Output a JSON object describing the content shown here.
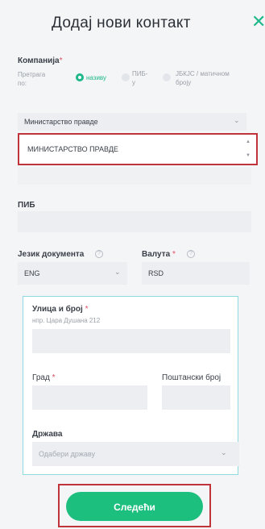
{
  "header": {
    "title": "Додај нови контакт",
    "close_glyph": "✕"
  },
  "company": {
    "label": "Компанија",
    "required_mark": "*",
    "search_by_label_1": "Претрага",
    "search_by_label_2": "по:",
    "options": [
      {
        "label_1": "називу",
        "label_2": "",
        "selected": true
      },
      {
        "label_1": "ПИБ-",
        "label_2": "у",
        "selected": false
      },
      {
        "label_1": "ЈБКЈС / матичном",
        "label_2": "броју",
        "selected": false
      }
    ],
    "selected_company": "Министарство правде",
    "result_value": "МИНИСТАРСТВО ПРАВДЕ"
  },
  "pib": {
    "label": "ПИБ",
    "value": ""
  },
  "document_language": {
    "label": "Језик документа",
    "value": "ENG"
  },
  "currency": {
    "label": "Валута",
    "required_mark": "*",
    "value": "RSD"
  },
  "address": {
    "street_label": "Улица и број",
    "street_required": "*",
    "street_hint": "нпр. Цара Душана 212",
    "city_label": "Град",
    "city_required": "*",
    "postal_label": "Поштански број",
    "country_label": "Држава",
    "country_placeholder": "Одабери државу"
  },
  "actions": {
    "next_label": "Следећи"
  },
  "colors": {
    "accent": "#1dbf7f",
    "highlight_border": "#c0333b",
    "address_border": "#8fd9e1"
  },
  "icons": {
    "help": "?",
    "chevron": "⌄",
    "spinner_up": "▲",
    "spinner_down": "▼"
  }
}
